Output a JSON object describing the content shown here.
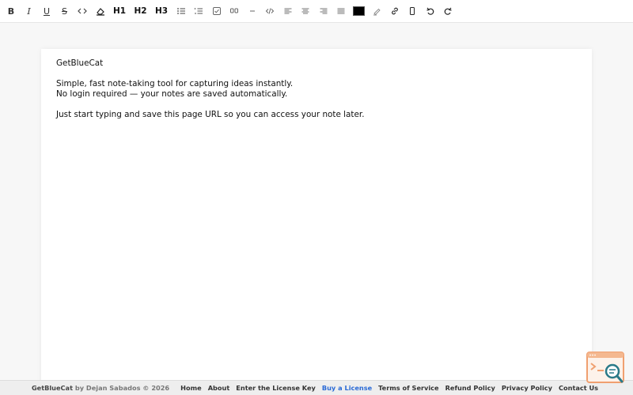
{
  "toolbar": {
    "buttons": [
      {
        "name": "bold-button",
        "label": "B",
        "icon": "bold"
      },
      {
        "name": "italic-button",
        "label": "I",
        "icon": "italic"
      },
      {
        "name": "underline-button",
        "label": "U",
        "icon": "underline"
      },
      {
        "name": "strikethrough-button",
        "label": "S",
        "icon": "strikethrough"
      },
      {
        "name": "inline-code-button",
        "label": "<>",
        "icon": "code-icon"
      },
      {
        "name": "clear-format-button",
        "label": "",
        "icon": "eraser-icon"
      },
      {
        "name": "h1-button",
        "label": "H1",
        "icon": "heading-1"
      },
      {
        "name": "h2-button",
        "label": "H2",
        "icon": "heading-2"
      },
      {
        "name": "h3-button",
        "label": "H3",
        "icon": "heading-3"
      }
    ],
    "text_color": "#000000"
  },
  "editor": {
    "lines": [
      "GetBlueCat",
      "",
      "Simple, fast note-taking tool for capturing ideas instantly.",
      "No login required — your notes are saved automatically.",
      "",
      "Just start typing and save this page URL so you can access your note later."
    ]
  },
  "footer": {
    "brand": "GetBlueCat",
    "credit": "by Dejan Sabados © 2026",
    "links": [
      {
        "label": "Home"
      },
      {
        "label": "About"
      },
      {
        "label": "Enter the License Key"
      },
      {
        "label": "Buy a License",
        "accent": "#2a6ad6"
      },
      {
        "label": "Terms of Service"
      },
      {
        "label": "Refund Policy"
      },
      {
        "label": "Privacy Policy"
      },
      {
        "label": "Contact Us"
      }
    ]
  },
  "colors": {
    "accent": "#2a6ad6",
    "badge_orange": "#f0a070",
    "badge_teal": "#2a7a88"
  }
}
